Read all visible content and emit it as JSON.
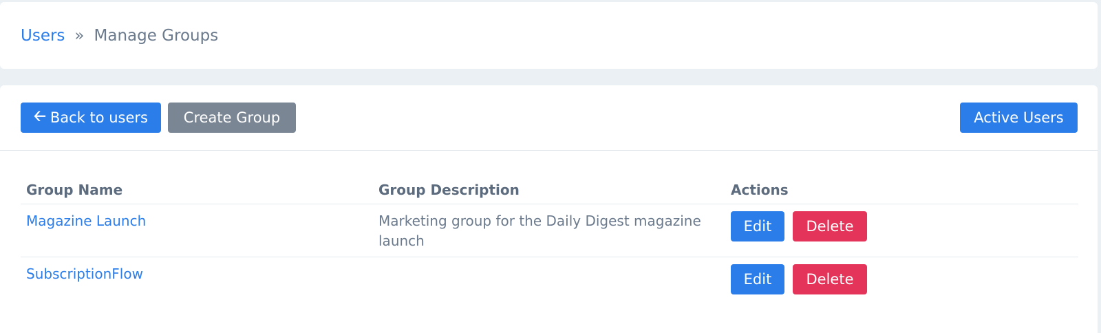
{
  "breadcrumb": {
    "link": "Users",
    "separator": "»",
    "current": "Manage Groups"
  },
  "toolbar": {
    "back_arrow_icon": "arrow-left-icon",
    "back_label": "Back to users",
    "create_label": "Create Group",
    "active_label": "Active Users"
  },
  "table": {
    "headers": [
      "Group Name",
      "Group Description",
      "Actions"
    ],
    "rows": [
      {
        "name": "Magazine Launch",
        "description": "Marketing group for the Daily Digest magazine launch",
        "edit_label": "Edit",
        "delete_label": "Delete"
      },
      {
        "name": "SubscriptionFlow",
        "description": "",
        "edit_label": "Edit",
        "delete_label": "Delete"
      }
    ]
  },
  "colors": {
    "primary": "#2b7de9",
    "secondary": "#7b8694",
    "danger": "#e5345a",
    "background": "#ebf0f5"
  }
}
